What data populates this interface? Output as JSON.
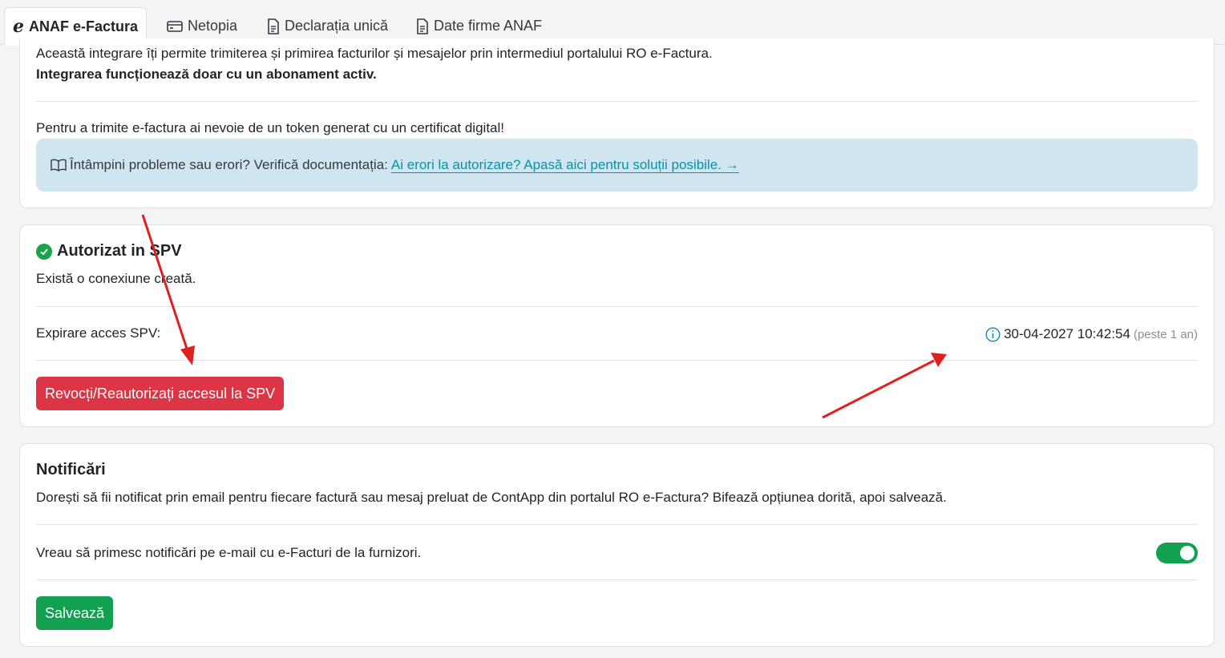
{
  "tabs": [
    {
      "label": "ANAF e-Factura",
      "icon": "e-factura-icon",
      "active": true
    },
    {
      "label": "Netopia",
      "icon": "credit-card-icon",
      "active": false
    },
    {
      "label": "Declarația unică",
      "icon": "document-icon",
      "active": false
    },
    {
      "label": "Date firme ANAF",
      "icon": "document-icon",
      "active": false
    }
  ],
  "intro": {
    "line1": "Această integrare îți permite trimiterea și primirea facturilor și mesajelor prin intermediul portalului RO e-Factura.",
    "line2": "Integrarea funcționează doar cu un abonament activ.",
    "token_text": "Pentru a trimite e-factura ai nevoie de un token generat cu un certificat digital!",
    "help_text": "Întâmpini probleme sau erori? Verifică documentația:",
    "help_link": "Ai erori la autorizare? Apasă aici pentru soluții posibile. →",
    "help_icon": "book-icon"
  },
  "spv": {
    "title": "Autorizat in SPV",
    "subtitle": "Există o conexiune creată.",
    "expiry_label": "Expirare acces SPV:",
    "expiry_value": "30-04-2027 10:42:54",
    "expiry_relative": "(peste 1 an)",
    "revoke_button": "Revocți/Reautorizați accesul la SPV"
  },
  "notifications": {
    "title": "Notificări",
    "description": "Dorești să fii notificat prin email pentru fiecare factură sau mesaj preluat de ContApp din portalul RO e-Factura? Bifează opțiunea dorită, apoi salvează.",
    "option_label": "Vreau să primesc notificări pe e-mail cu e-Facturi de la furnizori.",
    "option_enabled": true,
    "save_button": "Salvează"
  },
  "colors": {
    "danger": "#dc3545",
    "success": "#12a150",
    "info_bg": "#cfe6f0",
    "link": "#0d8fa6",
    "annotation_arrow": "#e02020"
  }
}
